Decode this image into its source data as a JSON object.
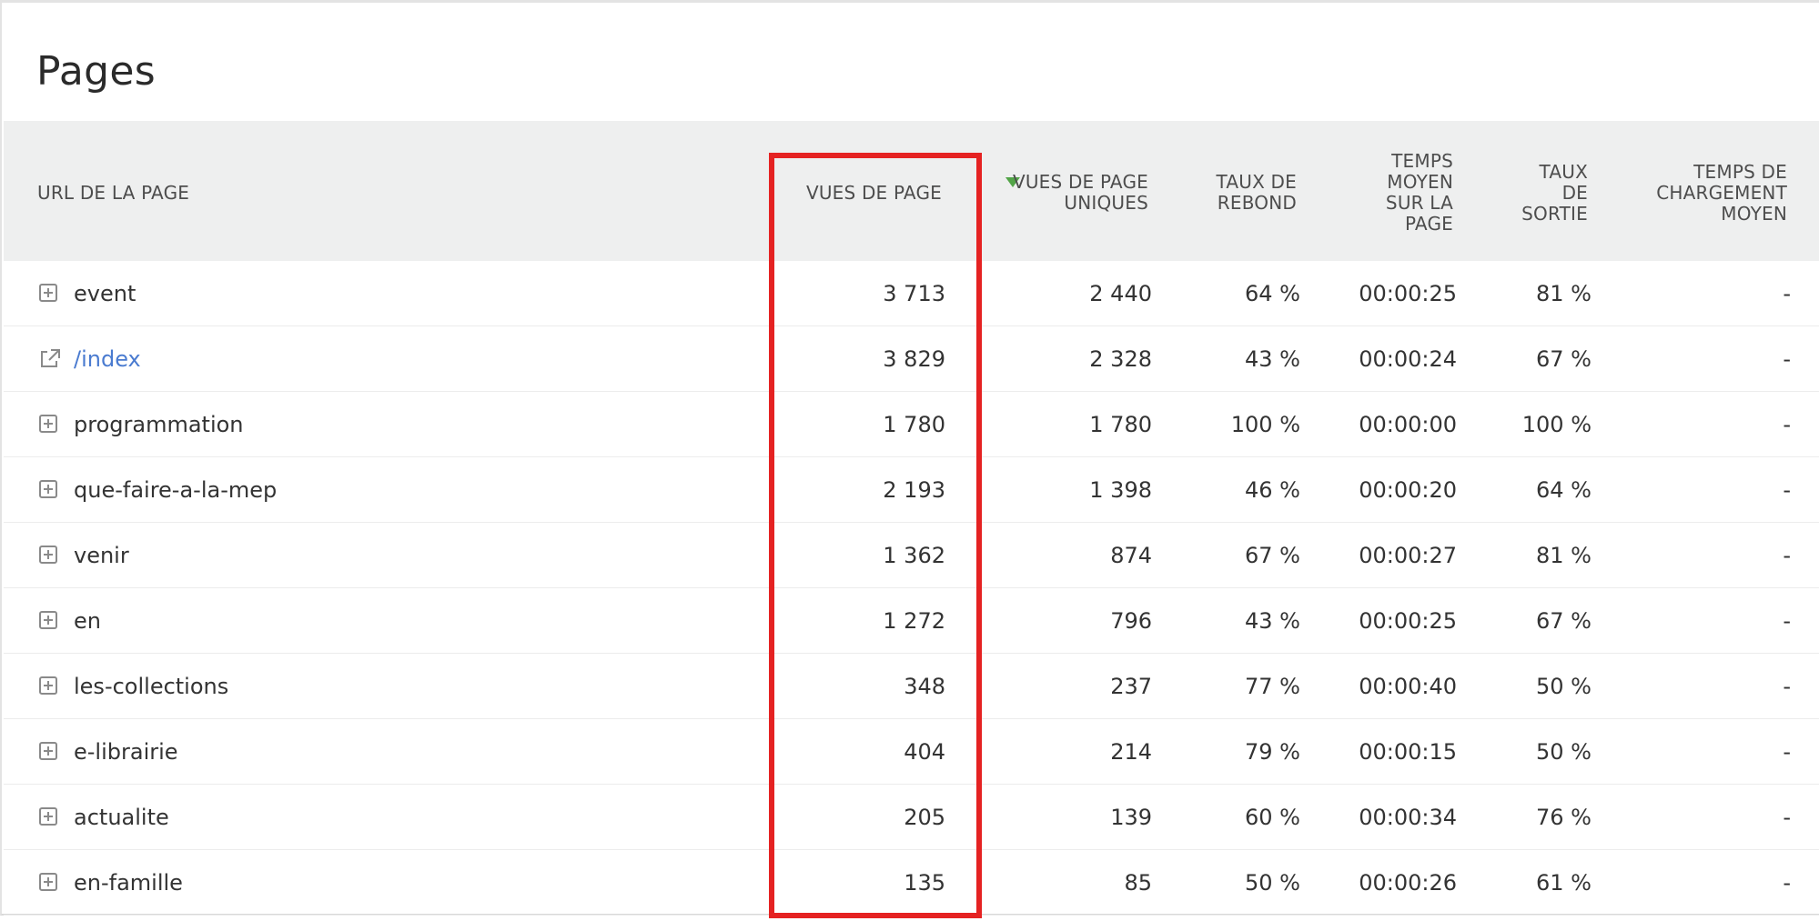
{
  "panel": {
    "title": "Pages"
  },
  "table": {
    "headers": {
      "url": "URL DE LA PAGE",
      "pageviews": "VUES DE PAGE",
      "unique_pageviews": [
        "VUES DE PAGE",
        "UNIQUES"
      ],
      "bounce_rate": [
        "TAUX DE",
        "REBOND"
      ],
      "avg_time": [
        "TEMPS",
        "MOYEN",
        "SUR LA",
        "PAGE"
      ],
      "exit_rate": [
        "TAUX",
        "DE",
        "SORTIE"
      ],
      "avg_load_time": [
        "TEMPS DE",
        "CHARGEMENT",
        "MOYEN"
      ]
    },
    "sort": {
      "column": "unique_pageviews",
      "direction": "desc",
      "icon": "sort-desc-icon",
      "color": "#52a447"
    },
    "rows": [
      {
        "url": "event",
        "icon": "expand-icon",
        "pageviews": "3 713",
        "unique": "2 440",
        "bounce": "64 %",
        "time": "00:00:25",
        "exit": "81 %",
        "load": "-"
      },
      {
        "url": "/index",
        "icon": "external-link-icon",
        "pageviews": "3 829",
        "unique": "2 328",
        "bounce": "43 %",
        "time": "00:00:24",
        "exit": "67 %",
        "load": "-"
      },
      {
        "url": "programmation",
        "icon": "expand-icon",
        "pageviews": "1 780",
        "unique": "1 780",
        "bounce": "100 %",
        "time": "00:00:00",
        "exit": "100 %",
        "load": "-"
      },
      {
        "url": "que-faire-a-la-mep",
        "icon": "expand-icon",
        "pageviews": "2 193",
        "unique": "1 398",
        "bounce": "46 %",
        "time": "00:00:20",
        "exit": "64 %",
        "load": "-"
      },
      {
        "url": "venir",
        "icon": "expand-icon",
        "pageviews": "1 362",
        "unique": "874",
        "bounce": "67 %",
        "time": "00:00:27",
        "exit": "81 %",
        "load": "-"
      },
      {
        "url": "en",
        "icon": "expand-icon",
        "pageviews": "1 272",
        "unique": "796",
        "bounce": "43 %",
        "time": "00:00:25",
        "exit": "67 %",
        "load": "-"
      },
      {
        "url": "les-collections",
        "icon": "expand-icon",
        "pageviews": "348",
        "unique": "237",
        "bounce": "77 %",
        "time": "00:00:40",
        "exit": "50 %",
        "load": "-"
      },
      {
        "url": "e-librairie",
        "icon": "expand-icon",
        "pageviews": "404",
        "unique": "214",
        "bounce": "79 %",
        "time": "00:00:15",
        "exit": "50 %",
        "load": "-"
      },
      {
        "url": "actualite",
        "icon": "expand-icon",
        "pageviews": "205",
        "unique": "139",
        "bounce": "60 %",
        "time": "00:00:34",
        "exit": "76 %",
        "load": "-"
      },
      {
        "url": "en-famille",
        "icon": "expand-icon",
        "pageviews": "135",
        "unique": "85",
        "bounce": "50 %",
        "time": "00:00:26",
        "exit": "61 %",
        "load": "-"
      }
    ]
  },
  "annotation": {
    "highlight_column": "pageviews",
    "color": "#e52222"
  },
  "colors": {
    "link": "#4a7bd0",
    "header_bg": "#eeefef"
  }
}
